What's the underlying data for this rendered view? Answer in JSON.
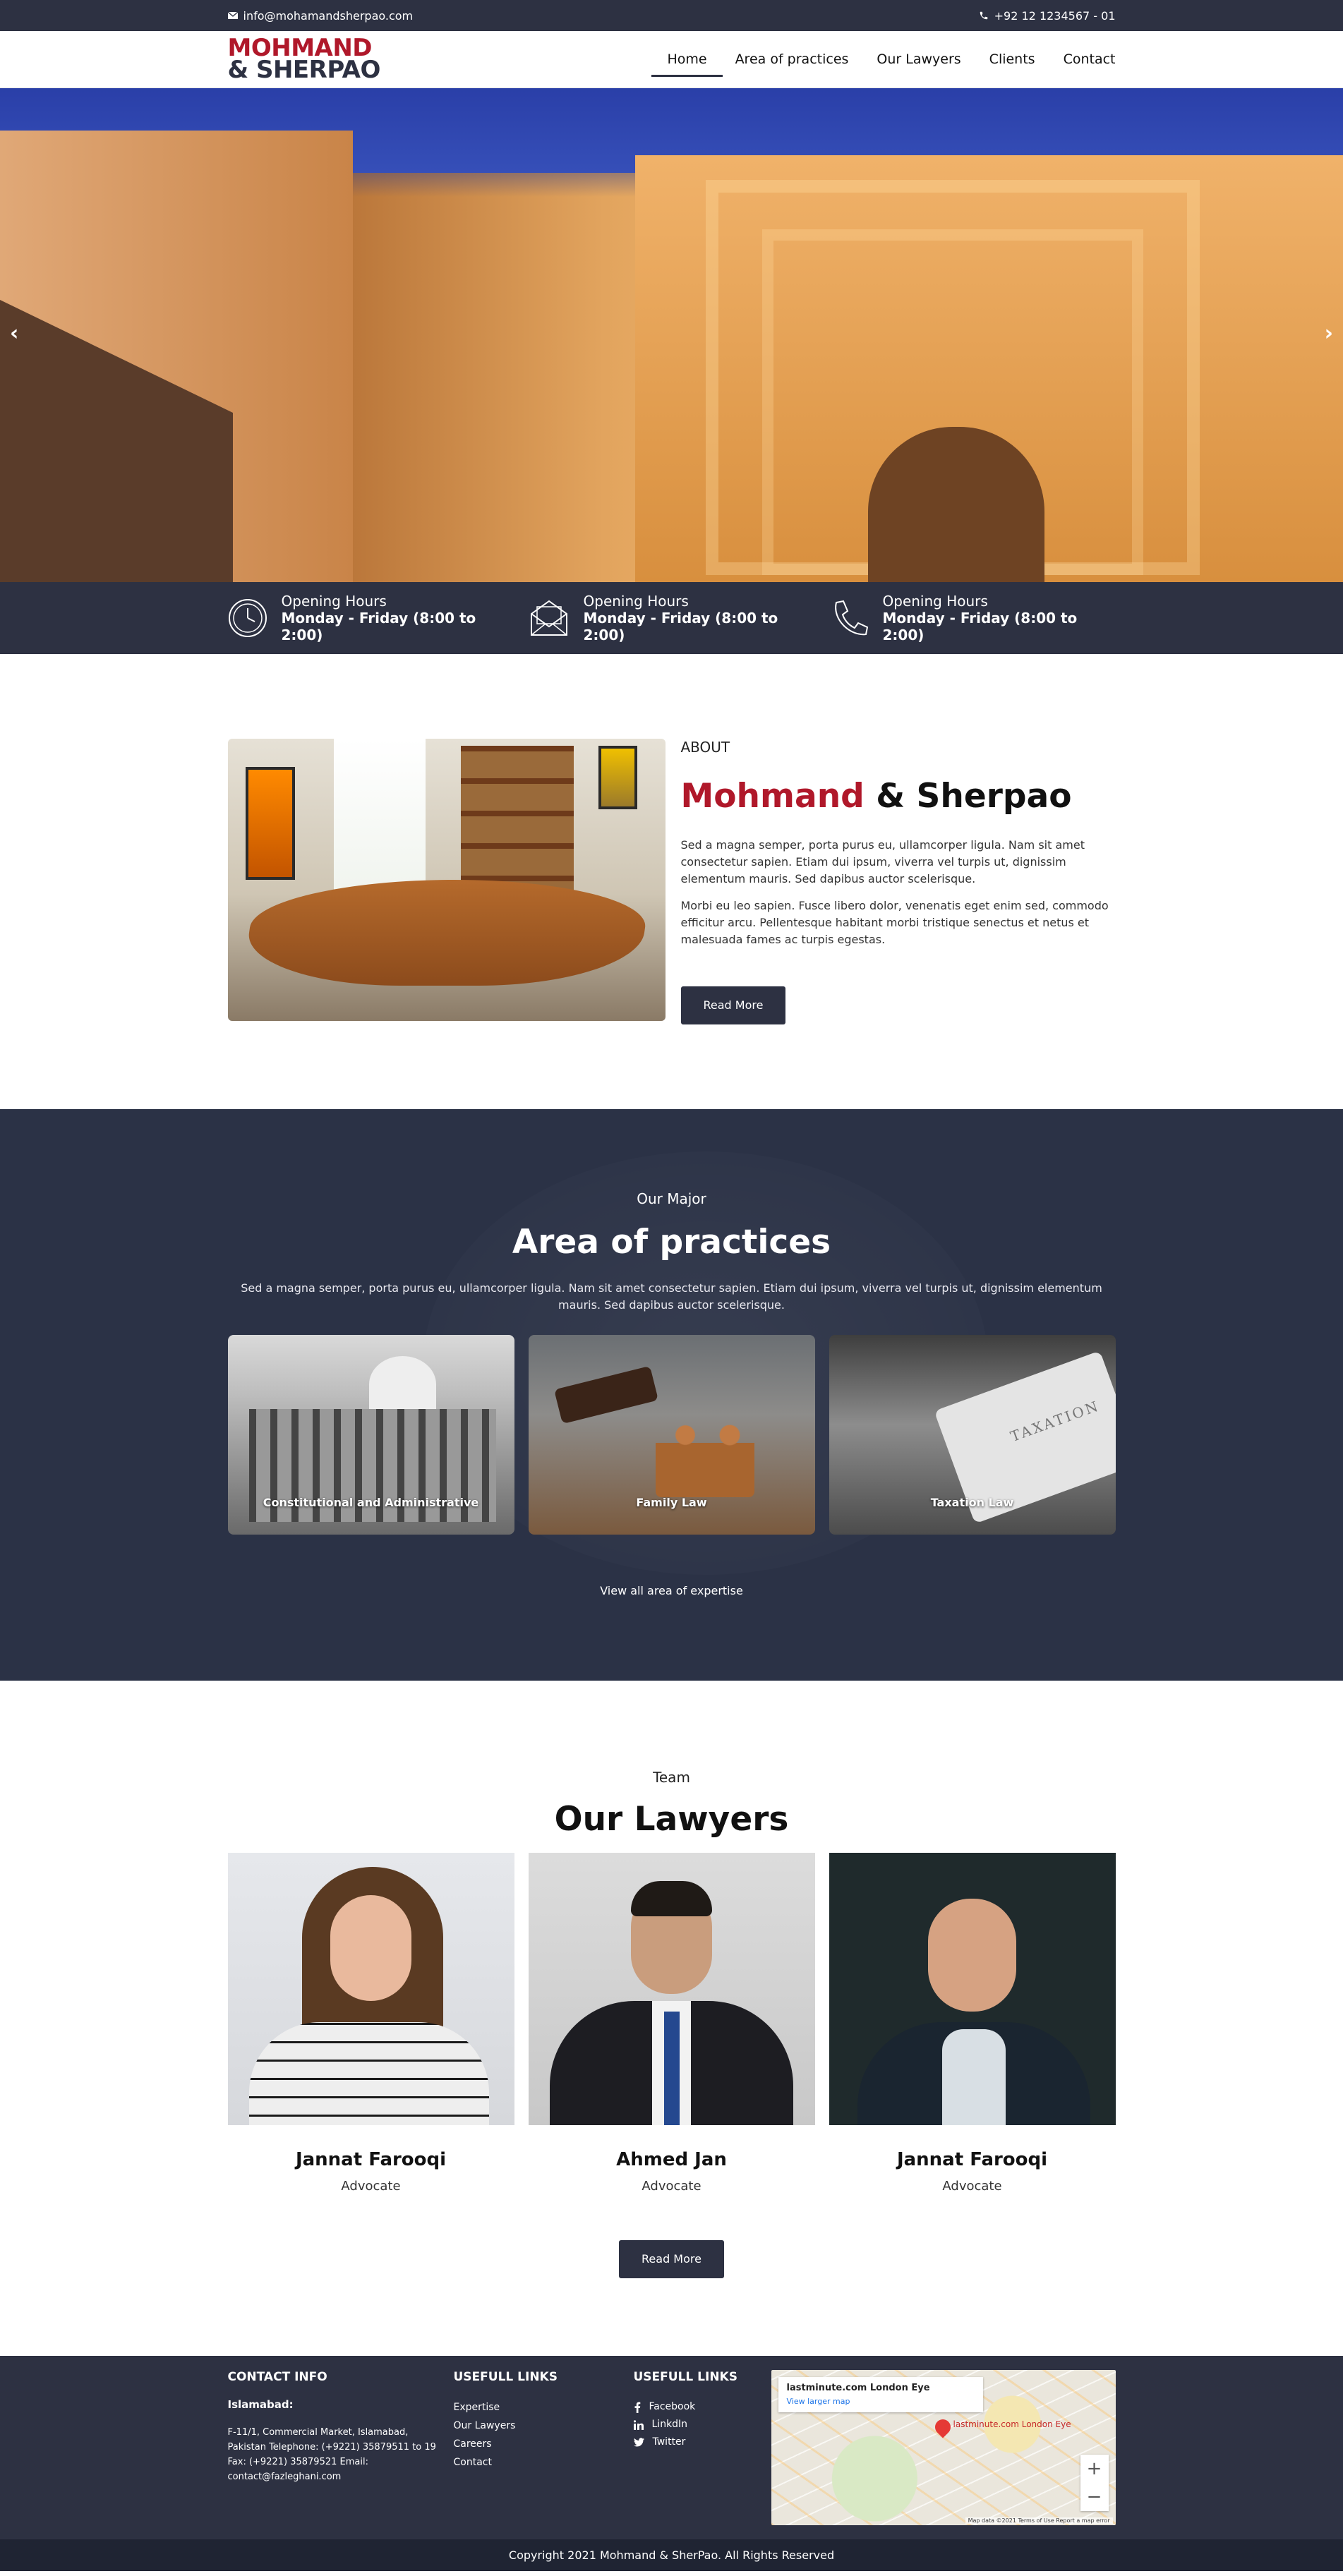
{
  "topbar": {
    "email": "info@mohamandsherpao.com",
    "phone": "+92 12 1234567 - 01"
  },
  "header": {
    "logo_line1": "MOHMAND",
    "logo_line2": "& SHERPAO",
    "nav": [
      "Home",
      "Area of practices",
      "Our Lawyers",
      "Clients",
      "Contact"
    ],
    "active_nav": "Home"
  },
  "hero": {
    "prev_icon": "chevron-left-icon",
    "next_icon": "chevron-right-icon"
  },
  "info_strip": [
    {
      "icon": "clock-icon",
      "title": "Opening Hours",
      "value": "Monday - Friday (8:00 to 2:00)"
    },
    {
      "icon": "envelope-icon",
      "title": "Opening Hours",
      "value": "Monday - Friday (8:00 to 2:00)"
    },
    {
      "icon": "phone-icon",
      "title": "Opening Hours",
      "value": "Monday - Friday (8:00 to 2:00)"
    }
  ],
  "about": {
    "label": "ABOUT",
    "title_red": "Mohmand",
    "title_rest": " & Sherpao",
    "para1": "Sed a magna semper, porta purus eu, ullamcorper ligula. Nam sit amet consectetur sapien. Etiam dui ipsum, viverra vel turpis ut, dignissim elementum mauris. Sed dapibus auctor scelerisque.",
    "para2": "Morbi eu leo sapien. Fusce libero dolor, venenatis eget enim sed, commodo efficitur arcu. Pellentesque habitant morbi tristique senectus et netus et malesuada fames ac turpis egestas.",
    "button": "Read More"
  },
  "practices": {
    "small": "Our Major",
    "title": "Area of practices",
    "desc": "Sed a magna semper, porta purus eu, ullamcorper ligula. Nam sit amet consectetur sapien. Etiam dui ipsum, viverra vel turpis ut, dignissim elementum mauris. Sed dapibus auctor scelerisque.",
    "cards": [
      {
        "caption": "Constitutional and Administrative"
      },
      {
        "caption": "Family Law"
      },
      {
        "caption": "Taxation Law"
      }
    ],
    "card3_book_text": "TAXATION",
    "view_all": "View all area of expertise"
  },
  "team": {
    "small": "Team",
    "title": "Our Lawyers",
    "lawyers": [
      {
        "name": "Jannat Farooqi",
        "role": "Advocate"
      },
      {
        "name": "Ahmed Jan",
        "role": "Advocate"
      },
      {
        "name": "Jannat Farooqi",
        "role": "Advocate"
      }
    ],
    "button": "Read More"
  },
  "footer": {
    "contact_title": "CONTACT INFO",
    "city": "Islamabad:",
    "address": "F-11/1, Commercial Market, Islamabad, Pakistan Telephone: (+9221) 35879511 to 19 Fax: (+9221) 35879521 Email: contact@fazleghani.com",
    "links_title": "USEFULL LINKS",
    "links": [
      "Expertise",
      "Our Lawyers",
      "Careers",
      "Contact"
    ],
    "social_title": "USEFULL LINKS",
    "social": [
      {
        "label": "Facebook",
        "icon": "facebook-icon"
      },
      {
        "label": "LinkdIn",
        "icon": "linkedin-icon"
      },
      {
        "label": "Twitter",
        "icon": "twitter-icon"
      }
    ],
    "map": {
      "place": "lastminute.com London Eye",
      "link": "View larger map",
      "pin_label": "lastminute.com London Eye",
      "zoom_in": "+",
      "zoom_out": "−",
      "attribution": "Map data ©2021   Terms of Use   Report a map error"
    }
  },
  "copyright": "Copyright 2021 Mohmand & SherPao. All Rights Reserved",
  "colors": {
    "navy": "#2d3142",
    "brand_red": "#b0182a"
  }
}
